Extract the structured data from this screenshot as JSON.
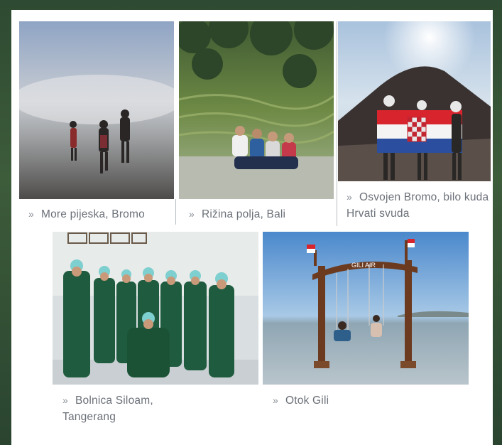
{
  "bullet": "»",
  "photos": [
    {
      "id": "bromo-sand",
      "caption": "More pijeska, Bromo"
    },
    {
      "id": "rice-fields",
      "caption": "Rižina polja, Bali"
    },
    {
      "id": "bromo-flag",
      "caption": "Osvojen Bromo, bilo kuda Hrvati svuda"
    },
    {
      "id": "hospital",
      "caption_line1": "Bolnica Siloam,",
      "caption_line2": "Tangerang"
    },
    {
      "id": "gili",
      "caption": "Otok Gili",
      "sign_text": "GILI AIR"
    }
  ]
}
